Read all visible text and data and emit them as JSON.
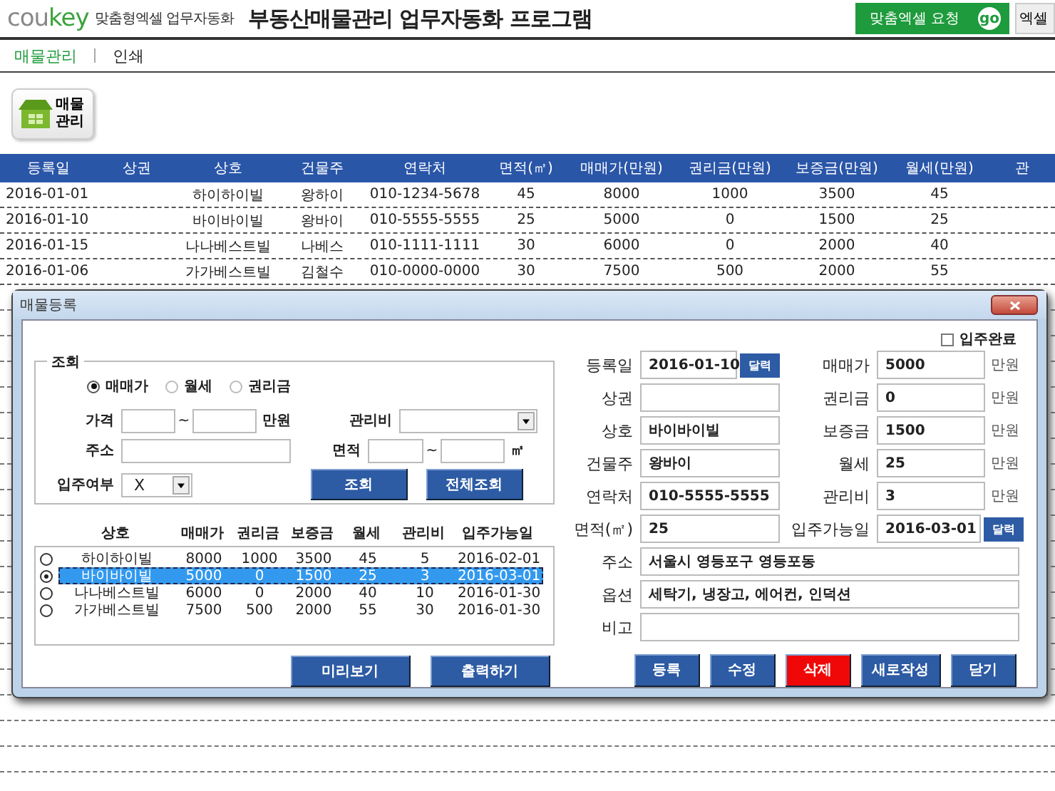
{
  "header": {
    "logo": {
      "part_a": "cou",
      "part_b": "key"
    },
    "tagline": "맞춤형엑셀 업무자동화",
    "title": "부동산매물관리 업무자동화 프로그램",
    "buttons": [
      {
        "label": "맞춤엑셀 요청",
        "kind": "go",
        "badge": "go"
      },
      {
        "label": "엑셀",
        "kind": "plain"
      }
    ]
  },
  "nav": [
    {
      "label": "매물관리",
      "selected": true
    },
    {
      "label": "인쇄",
      "selected": false
    }
  ],
  "toolbar": {
    "lines": [
      "매물",
      "관리"
    ]
  },
  "sheet": {
    "columns": [
      "등록일",
      "상권",
      "상호",
      "건물주",
      "연락처",
      "면적(㎡)",
      "매매가(만원)",
      "권리금(만원)",
      "보증금(만원)",
      "월세(만원)",
      "관"
    ],
    "rows": [
      [
        "2016-01-01",
        "",
        "하이하이빌",
        "왕하이",
        "010-1234-5678",
        "45",
        "8000",
        "1000",
        "3500",
        "45",
        ""
      ],
      [
        "2016-01-10",
        "",
        "바이바이빌",
        "왕바이",
        "010-5555-5555",
        "25",
        "5000",
        "0",
        "1500",
        "25",
        ""
      ],
      [
        "2016-01-15",
        "",
        "나나베스트빌",
        "나베스",
        "010-1111-1111",
        "30",
        "6000",
        "0",
        "2000",
        "40",
        ""
      ],
      [
        "2016-01-06",
        "",
        "가가베스트빌",
        "김철수",
        "010-0000-0000",
        "30",
        "7500",
        "500",
        "2000",
        "55",
        ""
      ]
    ]
  },
  "dialog": {
    "title": "매물등록",
    "search": {
      "legend": "조회",
      "options": [
        {
          "label": "매매가",
          "selected": true
        },
        {
          "label": "월세",
          "selected": false
        },
        {
          "label": "권리금",
          "selected": false
        }
      ],
      "price_label": "가격",
      "tilde_1": "~",
      "price_unit": "만원",
      "fee_label": "관리비",
      "address_label": "주소",
      "area_label": "면적",
      "tilde_2": "~",
      "area_unit": "㎡",
      "occupancy_label": "입주여부",
      "occupancy_value": "X",
      "buttons": [
        "조회",
        "전체조회"
      ]
    },
    "list": {
      "columns": [
        "상호",
        "매매가",
        "권리금",
        "보증금",
        "월세",
        "관리비",
        "입주가능일"
      ],
      "rows": [
        {
          "cells": [
            "하이하이빌",
            "8000",
            "1000",
            "3500",
            "45",
            "5",
            "2016-02-01"
          ],
          "selected": false
        },
        {
          "cells": [
            "바이바이빌",
            "5000",
            "0",
            "1500",
            "25",
            "3",
            "2016-03-01"
          ],
          "selected": true
        },
        {
          "cells": [
            "나나베스트빌",
            "6000",
            "0",
            "2000",
            "40",
            "10",
            "2016-01-30"
          ],
          "selected": false
        },
        {
          "cells": [
            "가가베스트빌",
            "7500",
            "500",
            "2000",
            "55",
            "30",
            "2016-01-30"
          ],
          "selected": false
        }
      ]
    },
    "list_buttons": [
      "미리보기",
      "출력하기"
    ],
    "completed": {
      "label": "입주완료",
      "checked": false
    },
    "form_rows": [
      {
        "label": "등록일",
        "value": "2016-01-10",
        "button": "달력",
        "label_2": "매매가",
        "value_2": "5000",
        "unit": "만원"
      },
      {
        "label": "상권",
        "value": "",
        "label_2": "권리금",
        "value_2": "0",
        "unit": "만원"
      },
      {
        "label": "상호",
        "value": "바이바이빌",
        "label_2": "보증금",
        "value_2": "1500",
        "unit": "만원"
      },
      {
        "label": "건물주",
        "value": "왕바이",
        "label_2": "월세",
        "value_2": "25",
        "unit": "만원"
      },
      {
        "label": "연락처",
        "value": "010-5555-5555",
        "label_2": "관리비",
        "value_2": "3",
        "unit": "만원"
      },
      {
        "label": "면적(㎡)",
        "value": "25",
        "label_2": "입주가능일",
        "value_2": "2016-03-01",
        "button_2": "달력"
      }
    ],
    "wide_rows": [
      {
        "label": "주소",
        "value": "서울시 영등포구 영등포동"
      },
      {
        "label": "옵션",
        "value": "세탁기, 냉장고, 에어컨, 인덕션"
      },
      {
        "label": "비고",
        "value": ""
      }
    ],
    "actions": [
      {
        "label": "등록",
        "kind": "normal"
      },
      {
        "label": "수정",
        "kind": "normal"
      },
      {
        "label": "삭제",
        "kind": "danger"
      },
      {
        "label": "새로작성",
        "kind": "normal"
      },
      {
        "label": "닫기",
        "kind": "normal"
      }
    ]
  }
}
